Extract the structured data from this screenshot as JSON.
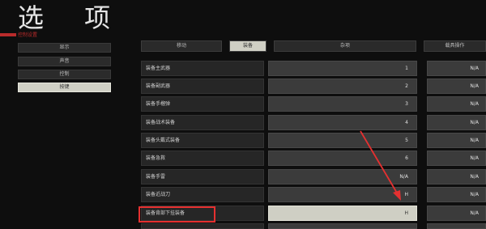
{
  "header": {
    "title": "选 项",
    "subtitle": "控制设置",
    "accent_color": "#b92b2b"
  },
  "sidebar": {
    "items": [
      {
        "label": "显示",
        "active": false
      },
      {
        "label": "声音",
        "active": false
      },
      {
        "label": "控制",
        "active": false
      },
      {
        "label": "按键",
        "active": true
      }
    ]
  },
  "tabs": [
    {
      "label": "移动",
      "active": false
    },
    {
      "label": "装备",
      "active": true
    },
    {
      "label": "杂项",
      "active": false
    },
    {
      "label": "载具操作",
      "active": false
    }
  ],
  "rows": [
    {
      "label": "装备主武器",
      "key1": "1",
      "key2": "N/A"
    },
    {
      "label": "装备副武器",
      "key1": "2",
      "key2": "N/A"
    },
    {
      "label": "装备手榴弹",
      "key1": "3",
      "key2": "N/A"
    },
    {
      "label": "装备战术装备",
      "key1": "4",
      "key2": "N/A"
    },
    {
      "label": "装备头戴式装备",
      "key1": "5",
      "key2": "N/A"
    },
    {
      "label": "装备急救",
      "key1": "6",
      "key2": "N/A"
    },
    {
      "label": "装备手雷",
      "key1": "N/A",
      "key2": "N/A"
    },
    {
      "label": "装备近战刀",
      "key1": "H",
      "key2": "N/A"
    },
    {
      "label": "装备背部下挂装备",
      "key1": "H",
      "key2": "N/A",
      "highlighted": true
    },
    {
      "label": "",
      "key1": "",
      "key2": ""
    }
  ],
  "annotation_color": "#e53030"
}
